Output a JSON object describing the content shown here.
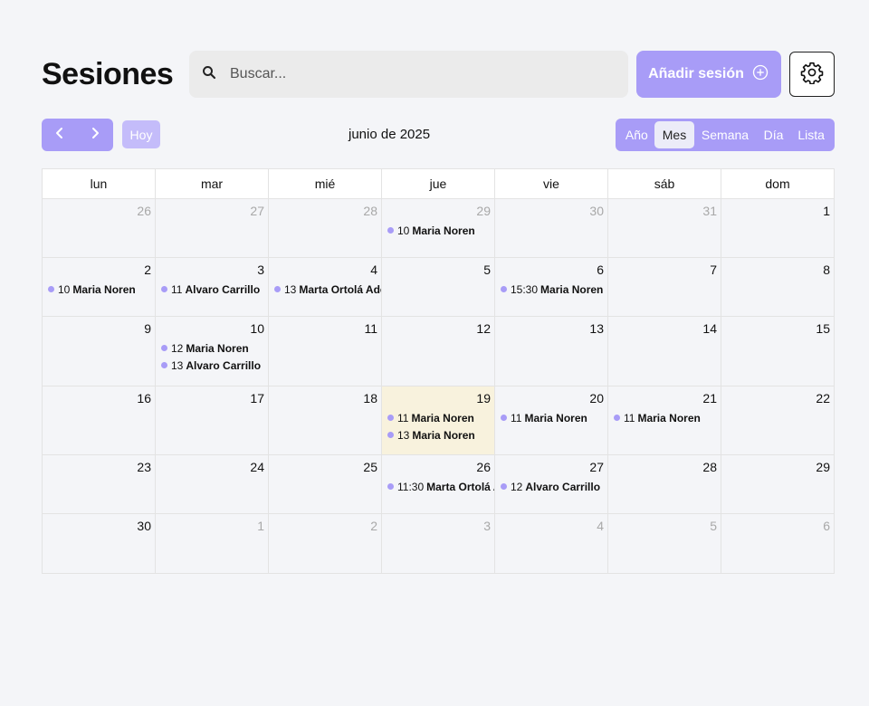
{
  "header": {
    "title": "Sesiones",
    "search_placeholder": "Buscar...",
    "add_label": "Añadir sesión"
  },
  "toolbar": {
    "today_label": "Hoy",
    "month_label": "junio de 2025",
    "views": [
      "Año",
      "Mes",
      "Semana",
      "Día",
      "Lista"
    ],
    "active_view": "Mes"
  },
  "colors": {
    "accent": "#a89cf7",
    "today_bg": "#f8f2dd"
  },
  "calendar": {
    "weekdays": [
      "lun",
      "mar",
      "mié",
      "jue",
      "vie",
      "sáb",
      "dom"
    ],
    "weeks": [
      [
        {
          "day": "26",
          "other": true,
          "events": []
        },
        {
          "day": "27",
          "other": true,
          "events": []
        },
        {
          "day": "28",
          "other": true,
          "events": []
        },
        {
          "day": "29",
          "other": true,
          "events": [
            {
              "time": "10",
              "name": "Maria Noren"
            }
          ]
        },
        {
          "day": "30",
          "other": true,
          "events": []
        },
        {
          "day": "31",
          "other": true,
          "events": []
        },
        {
          "day": "1",
          "other": false,
          "events": []
        }
      ],
      [
        {
          "day": "2",
          "other": false,
          "events": [
            {
              "time": "10",
              "name": "Maria Noren"
            }
          ]
        },
        {
          "day": "3",
          "other": false,
          "events": [
            {
              "time": "11",
              "name": "Alvaro Carrillo"
            }
          ]
        },
        {
          "day": "4",
          "other": false,
          "events": [
            {
              "time": "13",
              "name": "Marta Ortolá Adell"
            }
          ]
        },
        {
          "day": "5",
          "other": false,
          "events": []
        },
        {
          "day": "6",
          "other": false,
          "events": [
            {
              "time": "15:30",
              "name": "Maria Noren"
            }
          ]
        },
        {
          "day": "7",
          "other": false,
          "events": []
        },
        {
          "day": "8",
          "other": false,
          "events": []
        }
      ],
      [
        {
          "day": "9",
          "other": false,
          "events": []
        },
        {
          "day": "10",
          "other": false,
          "events": [
            {
              "time": "12",
              "name": "Maria Noren"
            },
            {
              "time": "13",
              "name": "Alvaro Carrillo"
            }
          ]
        },
        {
          "day": "11",
          "other": false,
          "events": []
        },
        {
          "day": "12",
          "other": false,
          "events": []
        },
        {
          "day": "13",
          "other": false,
          "events": []
        },
        {
          "day": "14",
          "other": false,
          "events": []
        },
        {
          "day": "15",
          "other": false,
          "events": []
        }
      ],
      [
        {
          "day": "16",
          "other": false,
          "events": []
        },
        {
          "day": "17",
          "other": false,
          "events": []
        },
        {
          "day": "18",
          "other": false,
          "events": []
        },
        {
          "day": "19",
          "other": false,
          "today": true,
          "events": [
            {
              "time": "11",
              "name": "Maria Noren"
            },
            {
              "time": "13",
              "name": "Maria Noren"
            }
          ]
        },
        {
          "day": "20",
          "other": false,
          "events": [
            {
              "time": "11",
              "name": "Maria Noren"
            }
          ]
        },
        {
          "day": "21",
          "other": false,
          "events": [
            {
              "time": "11",
              "name": "Maria Noren"
            }
          ]
        },
        {
          "day": "22",
          "other": false,
          "events": []
        }
      ],
      [
        {
          "day": "23",
          "other": false,
          "events": []
        },
        {
          "day": "24",
          "other": false,
          "events": []
        },
        {
          "day": "25",
          "other": false,
          "events": []
        },
        {
          "day": "26",
          "other": false,
          "events": [
            {
              "time": "11:30",
              "name": "Marta Ortolá Adell"
            }
          ]
        },
        {
          "day": "27",
          "other": false,
          "events": [
            {
              "time": "12",
              "name": "Alvaro Carrillo"
            }
          ]
        },
        {
          "day": "28",
          "other": false,
          "events": []
        },
        {
          "day": "29",
          "other": false,
          "events": []
        }
      ],
      [
        {
          "day": "30",
          "other": false,
          "events": []
        },
        {
          "day": "1",
          "other": true,
          "events": []
        },
        {
          "day": "2",
          "other": true,
          "events": []
        },
        {
          "day": "3",
          "other": true,
          "events": []
        },
        {
          "day": "4",
          "other": true,
          "events": []
        },
        {
          "day": "5",
          "other": true,
          "events": []
        },
        {
          "day": "6",
          "other": true,
          "events": []
        }
      ]
    ]
  }
}
